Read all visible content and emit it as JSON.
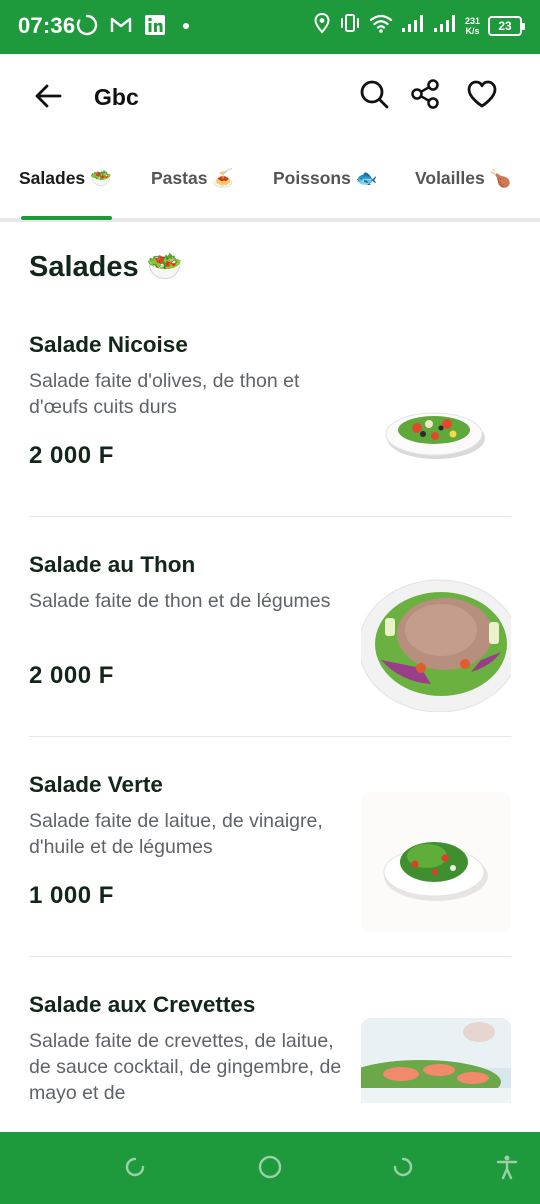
{
  "status_bar": {
    "time": "07:36",
    "net_speed_value": "231",
    "net_speed_unit": "K/s",
    "battery": "23",
    "icons": [
      "sync-icon",
      "gmail-icon",
      "linkedin-icon",
      "dot-icon",
      "location-icon",
      "vibrate-icon",
      "wifi-icon",
      "signal-icon",
      "signal-icon",
      "battery-icon"
    ]
  },
  "app_bar": {
    "title": "Gbc",
    "icons": [
      "back-arrow-icon",
      "search-icon",
      "share-icon",
      "heart-icon"
    ]
  },
  "tabs": [
    {
      "label": "Salades 🥗",
      "active": true
    },
    {
      "label": "Pastas 🍝",
      "active": false
    },
    {
      "label": "Poissons 🐟",
      "active": false
    },
    {
      "label": "Volailles 🍗",
      "active": false
    }
  ],
  "section": {
    "title": "Salades 🥗"
  },
  "items": [
    {
      "name": "Salade Nicoise",
      "description": "Salade faite d'olives, de thon et d'œufs cuits durs",
      "price": "2 000 F",
      "image": "salad-nicoise-image"
    },
    {
      "name": "Salade au Thon",
      "description": "Salade faite de thon et de légumes",
      "price": "2 000 F",
      "image": "tuna-salad-image"
    },
    {
      "name": "Salade Verte",
      "description": "Salade faite de laitue, de vinaigre, d'huile et de légumes",
      "price": "1 000 F",
      "image": "green-salad-image"
    },
    {
      "name": "Salade aux Crevettes",
      "description": "Salade faite de crevettes, de laitue, de sauce cocktail, de gingembre, de mayo et de",
      "price": "",
      "image": "shrimp-salad-image"
    }
  ],
  "nav_bar": {
    "icons": [
      "recents-icon",
      "home-icon",
      "back-icon",
      "accessibility-icon"
    ]
  },
  "colors": {
    "brand_green": "#1e9a3d",
    "text_dark": "#12261a",
    "text_muted": "#5f6368"
  }
}
